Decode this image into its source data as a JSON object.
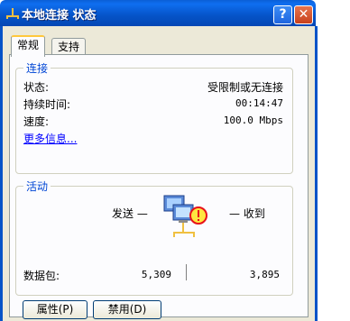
{
  "window": {
    "title": "本地连接 状态",
    "help_label": "?",
    "close_label": "✕",
    "title_icon": "network-connection-icon",
    "title_bar_color": "#0553c8"
  },
  "tabs": [
    {
      "label": "常规",
      "selected": true
    },
    {
      "label": "支持",
      "selected": false
    }
  ],
  "connection": {
    "legend": "连接",
    "rows": [
      {
        "label": "状态:",
        "value": "受限制或无连接"
      },
      {
        "label": "持续时间:",
        "value": "00:14:47"
      },
      {
        "label": "速度:",
        "value": "100.0 Mbps"
      }
    ],
    "more_info": "更多信息..."
  },
  "activity": {
    "legend": "活动",
    "sent_label": "发送 —",
    "received_label": "— 收到",
    "packets_label": "数据包:",
    "packets_sent": "5,309",
    "packets_received": "3,895",
    "icon": "network-computers-warning-icon"
  },
  "buttons": {
    "properties": "属性(P)",
    "disable": "禁用(D)"
  },
  "colors": {
    "legend": "#0046d5",
    "link": "#0000ff",
    "warning": "#e8101a"
  }
}
